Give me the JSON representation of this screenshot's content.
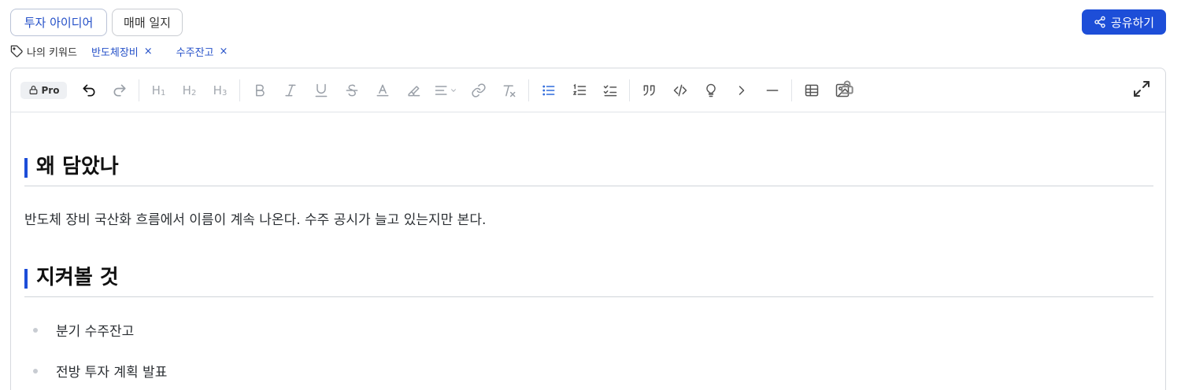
{
  "tabs": {
    "idea_label": "투자 아이디어",
    "journal_label": "매매 일지"
  },
  "share": {
    "label": "공유하기"
  },
  "keywords": {
    "label": "나의 키워드",
    "chips": [
      "반도체장비",
      "수주잔고"
    ],
    "remove_glyph": "×"
  },
  "toolbar": {
    "pro_label": "Pro",
    "headings": [
      {
        "main": "H",
        "sub": "1"
      },
      {
        "main": "H",
        "sub": "2"
      },
      {
        "main": "H",
        "sub": "3"
      }
    ]
  },
  "document": {
    "heading1": "왜 담았나",
    "paragraph1": "반도체 장비 국산화 흐름에서 이름이 계속 나온다. 수주 공시가 늘고 있는지만 본다.",
    "heading2": "지켜볼 것",
    "bullets": [
      "분기 수주잔고",
      "전방 투자 계획 발표"
    ]
  },
  "colors": {
    "accent": "#1d4ed8",
    "link": "#2450c8",
    "muted_icon": "#9aa0a8"
  }
}
